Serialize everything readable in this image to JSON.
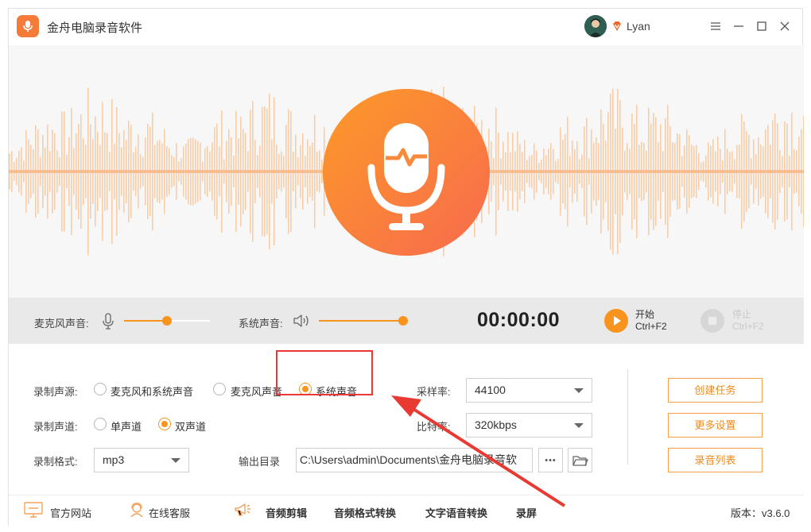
{
  "app": {
    "title": "金舟电脑录音软件",
    "username": "Lyan",
    "accent_color": "#f8941d",
    "icons": [
      "mic-logo-icon",
      "vip-diamond-icon",
      "menu-icon",
      "minimize-icon",
      "maximize-icon",
      "close-icon"
    ]
  },
  "control_bar": {
    "mic_label": "麦克风声音:",
    "mic_volume": 0.5,
    "sys_label": "系统声音:",
    "sys_volume": 1.0,
    "timer": "00:00:00",
    "start_label": "开始",
    "start_shortcut": "Ctrl+F2",
    "stop_label": "停止",
    "stop_shortcut": "Ctrl+F2"
  },
  "settings": {
    "source_label": "录制声源:",
    "source_options": [
      "麦克风和系统声音",
      "麦克风声音",
      "系统声音"
    ],
    "source_selected": "系统声音",
    "channel_label": "录制声道:",
    "channel_options": [
      "单声道",
      "双声道"
    ],
    "channel_selected": "双声道",
    "format_label": "录制格式:",
    "format_value": "mp3",
    "output_label": "输出目录",
    "output_path": "C:\\Users\\admin\\Documents\\金舟电脑录音软",
    "more_dots": "•••",
    "sample_rate_label": "采样率:",
    "sample_rate_value": "44100",
    "bitrate_label": "比特率:",
    "bitrate_value": "320kbps"
  },
  "actions": {
    "create_task": "创建任务",
    "more_settings": "更多设置",
    "recording_list": "录音列表"
  },
  "footer": {
    "website": "官方网站",
    "online_service": "在线客服",
    "audio_edit": "音频剪辑",
    "audio_convert": "音频格式转换",
    "text_to_speech": "文字语音转换",
    "screen_record": "录屏",
    "version": "版本：v3.6.0"
  }
}
